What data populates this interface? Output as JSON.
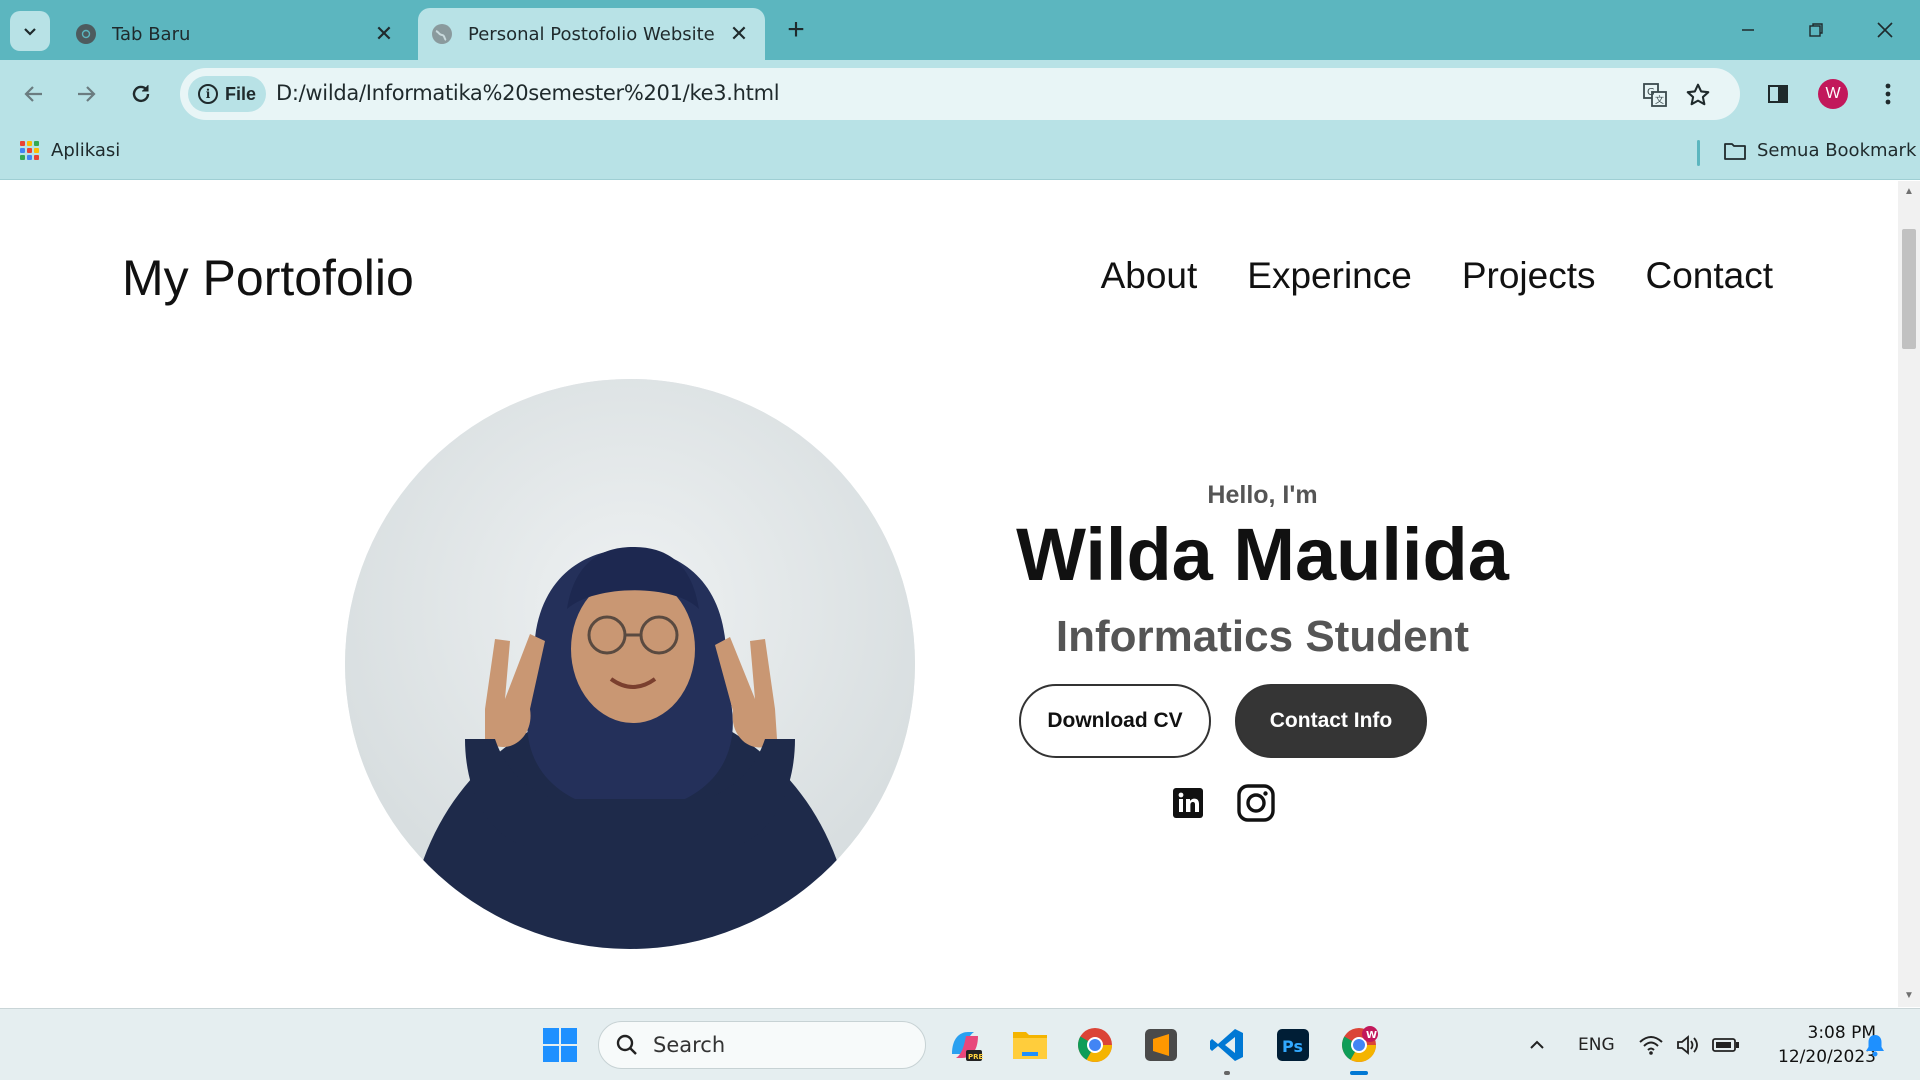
{
  "browser": {
    "tabs": [
      {
        "title": "Tab Baru",
        "active": false
      },
      {
        "title": "Personal Postofolio Website",
        "active": true
      }
    ],
    "site_info_chip": "File",
    "url": "D:/wilda/Informatika%20semester%201/ke3.html",
    "profile_initial": "W",
    "bookmarks": {
      "apps_label": "Aplikasi",
      "all_bookmarks_label": "Semua Bookmark"
    }
  },
  "page": {
    "logo": "My Portofolio",
    "nav": [
      {
        "label": "About"
      },
      {
        "label": "Experince"
      },
      {
        "label": "Projects"
      },
      {
        "label": "Contact"
      }
    ],
    "hero": {
      "greeting": "Hello, I'm",
      "name": "Wilda Maulida",
      "role": "Informatics Student",
      "buttons": {
        "download_cv": "Download CV",
        "contact_info": "Contact Info"
      },
      "socials": [
        "linkedin-icon",
        "instagram-icon"
      ]
    }
  },
  "taskbar": {
    "search_placeholder": "Search",
    "language": "ENG",
    "time": "3:08 PM",
    "date": "12/20/2023",
    "chrome_badge": "W"
  },
  "colors": {
    "titlebar": "#5cb6bf",
    "toolbar": "#b8e2e6",
    "dark_button": "#353535",
    "accent": "#0078d4"
  }
}
